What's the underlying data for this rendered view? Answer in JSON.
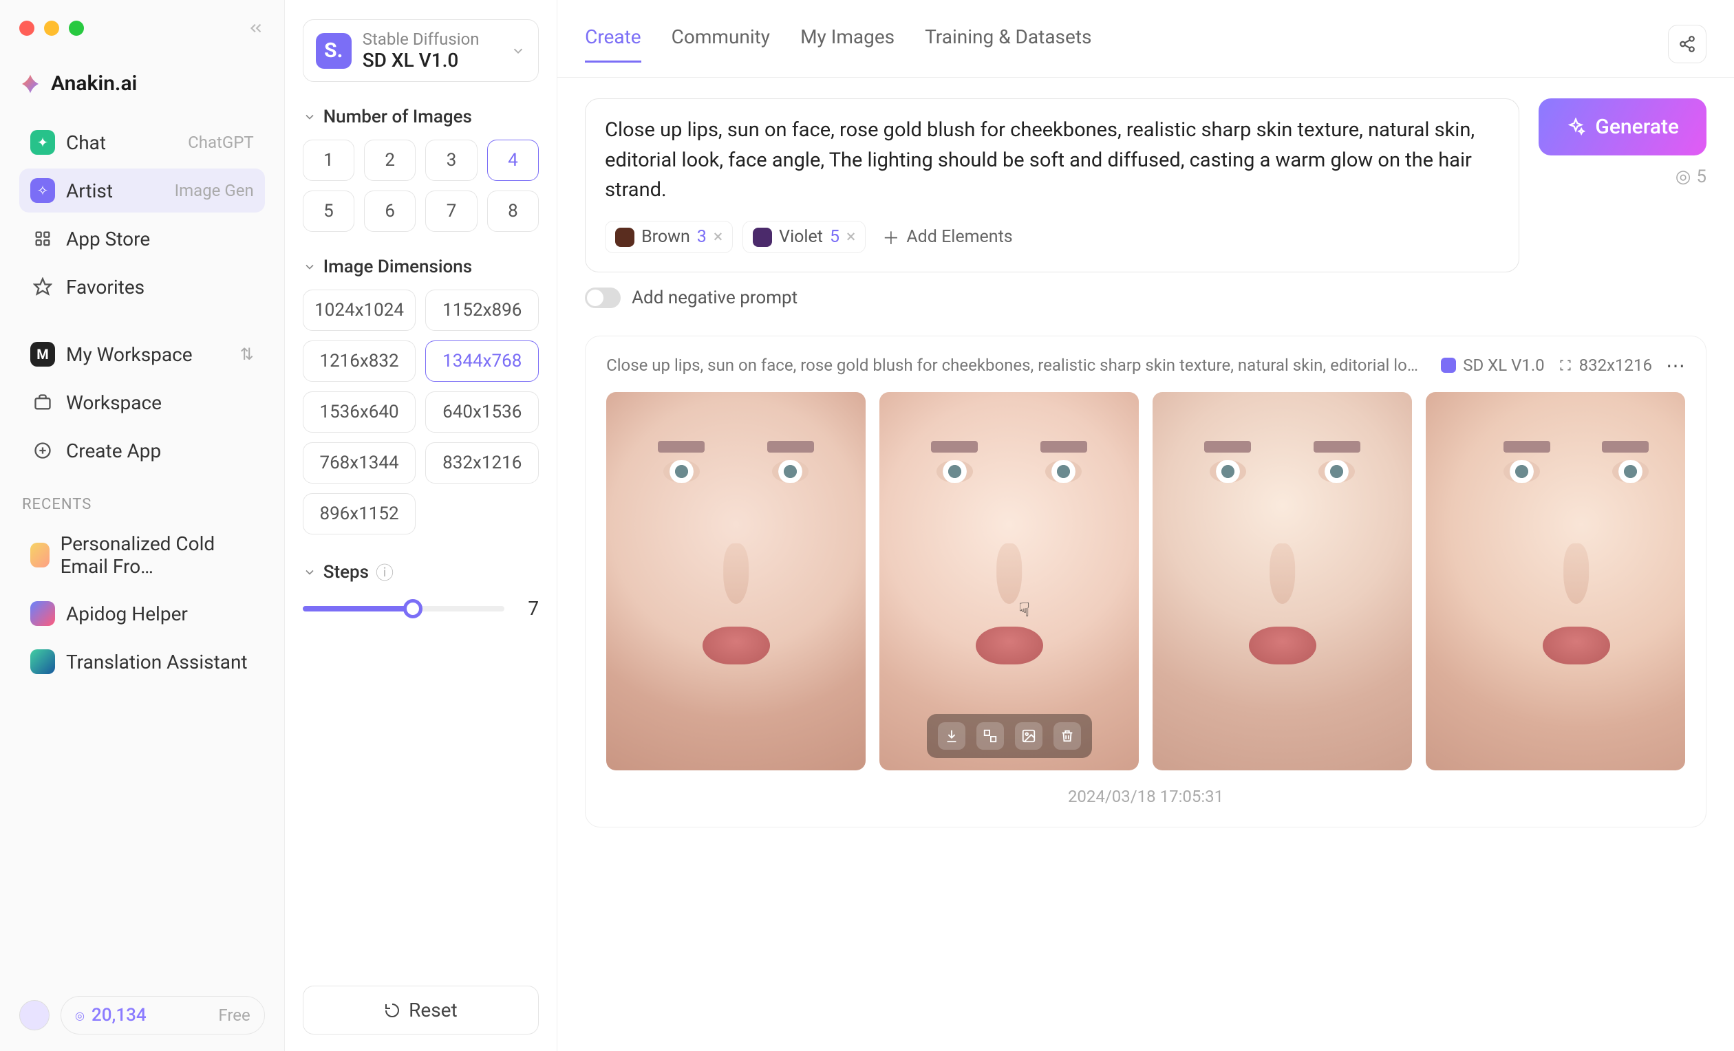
{
  "brand": {
    "name": "Anakin.ai"
  },
  "sidebar": {
    "items": [
      {
        "label": "Chat",
        "tag": "ChatGPT"
      },
      {
        "label": "Artist",
        "tag": "Image Gen"
      },
      {
        "label": "App Store"
      },
      {
        "label": "Favorites"
      }
    ],
    "workspace": [
      {
        "label": "My Workspace"
      },
      {
        "label": "Workspace"
      },
      {
        "label": "Create App"
      }
    ],
    "recents_label": "RECENTS",
    "recents": [
      {
        "label": "Personalized Cold Email Fro…"
      },
      {
        "label": "Apidog Helper"
      },
      {
        "label": "Translation Assistant"
      }
    ],
    "credits": "20,134",
    "plan": "Free"
  },
  "tabs_main": [
    "Create",
    "Community",
    "My Images",
    "Training & Datasets"
  ],
  "model": {
    "family": "Stable Diffusion",
    "name": "SD XL V1.0"
  },
  "sections": {
    "num_images": {
      "title": "Number of Images",
      "options": [
        "1",
        "2",
        "3",
        "4",
        "5",
        "6",
        "7",
        "8"
      ],
      "selected": "4"
    },
    "dimensions": {
      "title": "Image Dimensions",
      "options": [
        "1024x1024",
        "1152x896",
        "1216x832",
        "1344x768",
        "1536x640",
        "640x1536",
        "768x1344",
        "832x1216",
        "896x1152"
      ],
      "selected": "1344x768"
    },
    "steps": {
      "title": "Steps",
      "value": 7,
      "min": 1,
      "max": 12
    }
  },
  "reset_label": "Reset",
  "prompt": "Close up lips, sun on face, rose gold blush for cheekbones, realistic sharp skin texture, natural skin, editorial look, face angle, The lighting should be soft and diffused, casting a warm glow on the hair strand.",
  "elements": [
    {
      "name": "Brown",
      "n": 3,
      "color": "#5a2d1f"
    },
    {
      "name": "Violet",
      "n": 5,
      "color": "#4b2a6b"
    }
  ],
  "add_elements_label": "Add Elements",
  "generate_label": "Generate",
  "gen_cost": 5,
  "neg_prompt_label": "Add negative prompt",
  "result": {
    "prompt_short": "Close up lips, sun on face, rose gold blush for cheekbones, realistic sharp skin texture, natural skin, editorial look, face…",
    "model": "SD XL V1.0",
    "dim": "832x1216",
    "timestamp": "2024/03/18 17:05:31"
  }
}
